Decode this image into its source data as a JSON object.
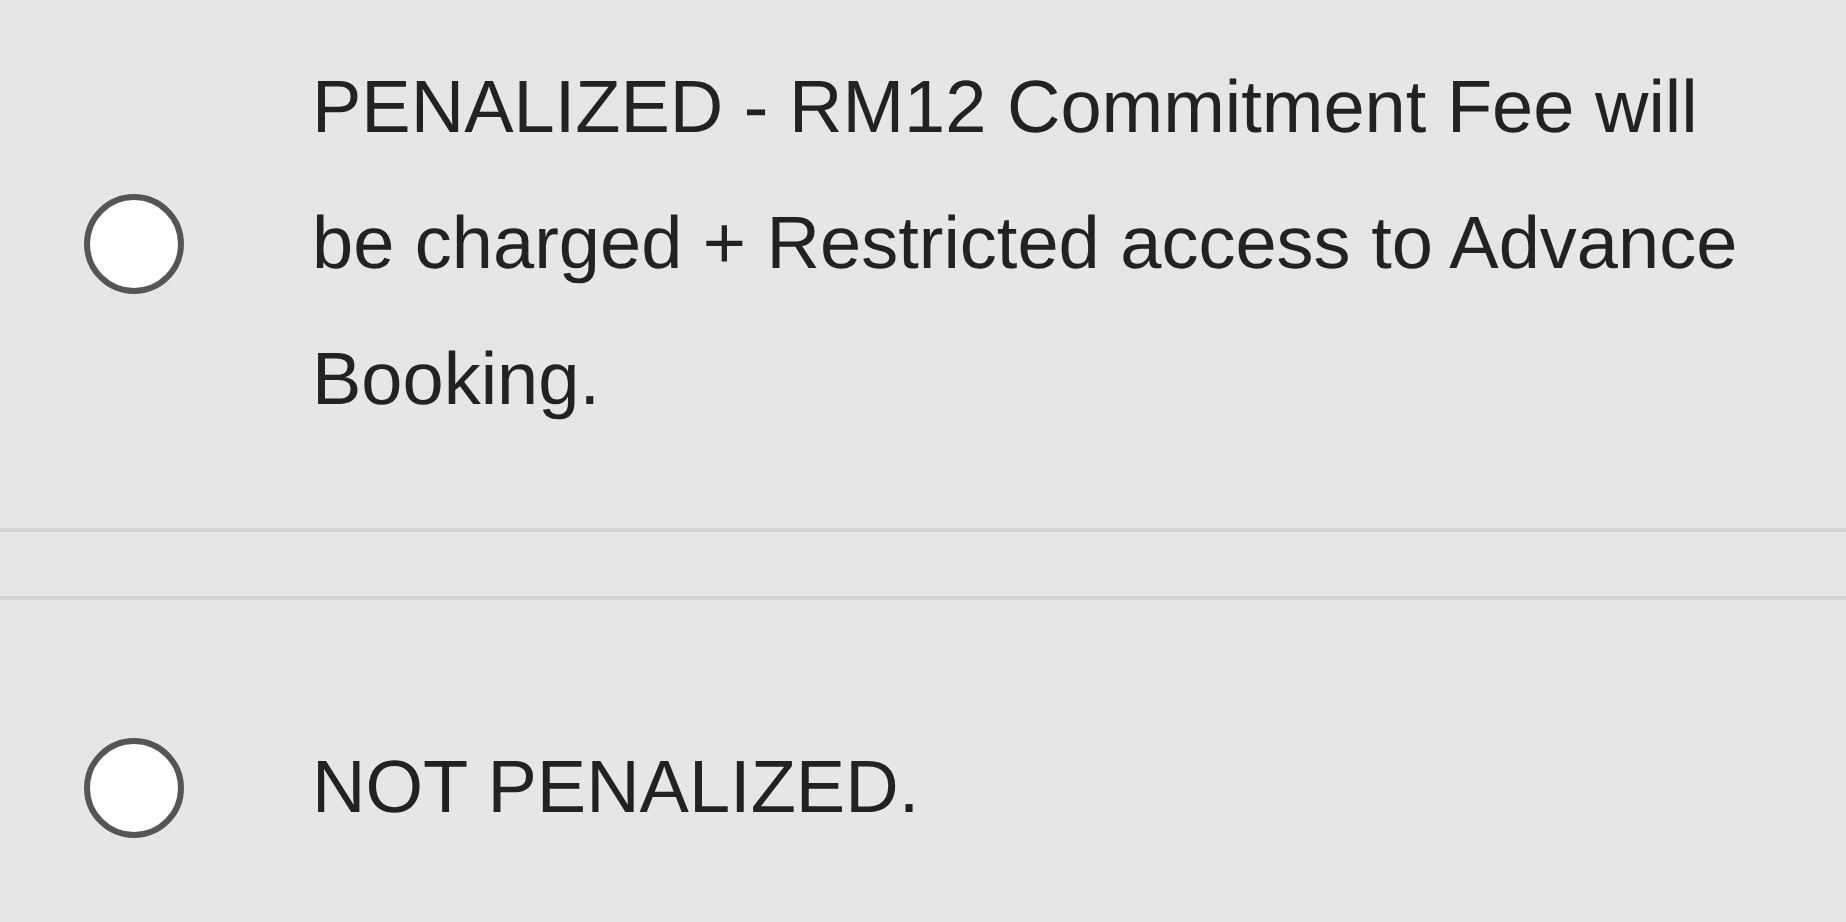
{
  "options": [
    {
      "label": "PENALIZED - RM12 Commitment Fee will be charged + Restricted access to Advance Booking.",
      "selected": false
    },
    {
      "label": "NOT PENALIZED.",
      "selected": false
    }
  ]
}
